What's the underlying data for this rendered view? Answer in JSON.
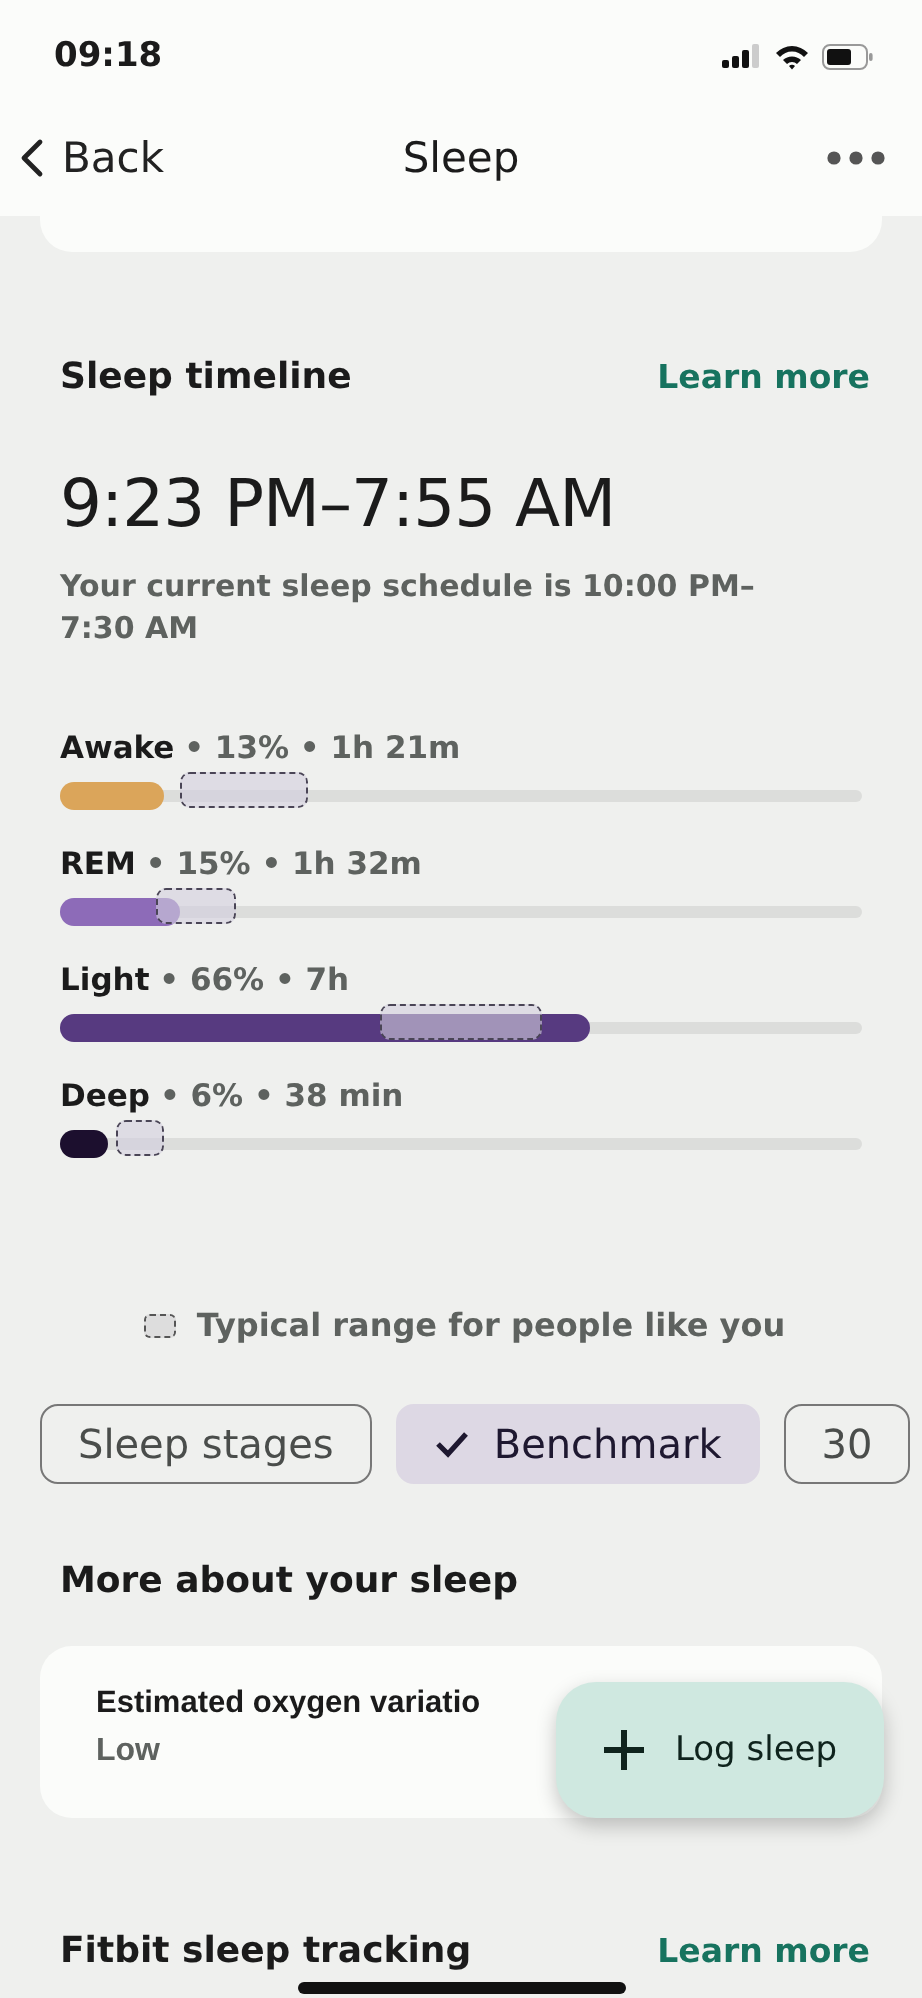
{
  "status_bar": {
    "time": "09:18"
  },
  "nav": {
    "back": "Back",
    "title": "Sleep"
  },
  "timeline": {
    "title": "Sleep timeline",
    "link": "Learn more",
    "range": "9:23 PM–7:55 AM",
    "schedule": "Your current sleep schedule is 10:00 PM–7:30 AM",
    "stages": [
      {
        "name": "Awake",
        "stats": "• 13% • 1h 21m",
        "level": 0.13,
        "color": "#dba55a"
      },
      {
        "name": "REM",
        "stats": "• 15% • 1h 32m",
        "level": 0.15,
        "color": "#8d6bb8"
      },
      {
        "name": "Light",
        "stats": "• 66% • 7h",
        "level": 0.66,
        "color": "#573a80"
      },
      {
        "name": "Deep",
        "stats": "• 6% • 38 min",
        "level": 0.06,
        "color": "#1c0f2e"
      }
    ],
    "legend": "Typical range for people like you"
  },
  "chips": [
    {
      "label": "Sleep stages",
      "selected": false
    },
    {
      "label": "Benchmark",
      "selected": true
    },
    {
      "label": "30",
      "selected": false
    }
  ],
  "more": {
    "title": "More about your sleep",
    "card_title": "Estimated oxygen variatio",
    "card_value": "Low"
  },
  "fab": {
    "label": "Log sleep"
  },
  "next_section": {
    "title": "Fitbit sleep tracking",
    "link": "Learn more"
  }
}
